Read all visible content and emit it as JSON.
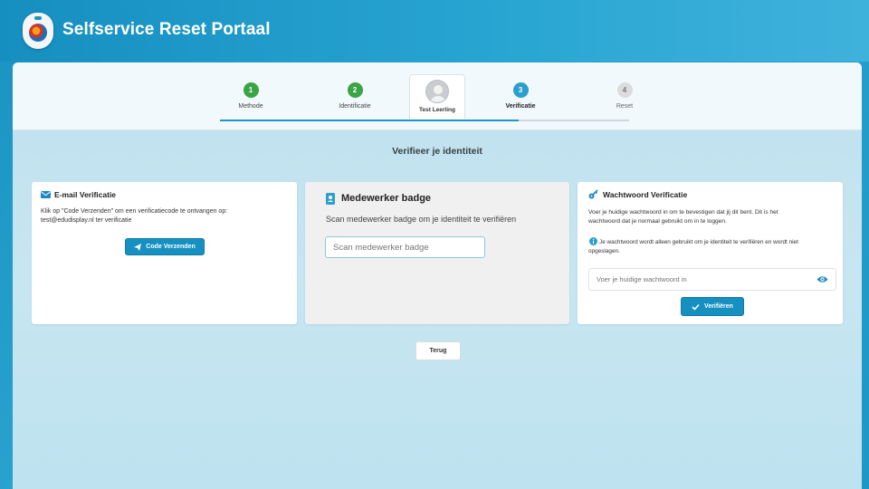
{
  "app": {
    "title": "Selfservice Reset Portaal"
  },
  "steps": [
    {
      "number": "1",
      "label": "Methode",
      "state": "done"
    },
    {
      "number": "2",
      "label": "Identificatie",
      "state": "done"
    },
    {
      "number": "3",
      "label": "Verificatie",
      "state": "active"
    },
    {
      "number": "4",
      "label": "Reset",
      "state": "future"
    }
  ],
  "user": {
    "name": "Test Leerling"
  },
  "page": {
    "heading": "Verifieer je identiteit"
  },
  "email_card": {
    "title": "E-mail Verificatie",
    "text_line1": "Klik op \"Code Verzenden\" om een verificatiecode te ontvangen op:",
    "text_line2": "test@edudisplay.nl ter verificatie",
    "button_label": "Code Verzenden"
  },
  "badge_card": {
    "title": "Medewerker badge",
    "description": "Scan medewerker badge om je identiteit te verifiëren",
    "input_placeholder": "Scan medewerker badge"
  },
  "password_card": {
    "title": "Wachtwoord Verificatie",
    "text_line1": "Voer je huidige wachtwoord in om te bevestigen dat jij dit bent. Dit is het",
    "text_line2": "wachtwoord dat je normaal gebruikt om in te loggen.",
    "info_line1": "Je wachtwoord wordt alleen gebruikt om je identiteit te verifiëren en wordt niet",
    "info_line2": "opgeslagen.",
    "input_placeholder": "Voer je huidige wachtwoord in",
    "button_label": "Verifiëren"
  },
  "back_button": {
    "label": "Terug"
  },
  "colors": {
    "primary": "#168fc1",
    "step_done": "#3aa447",
    "step_active": "#2d9fcf",
    "step_future": "#dcdcdc"
  }
}
